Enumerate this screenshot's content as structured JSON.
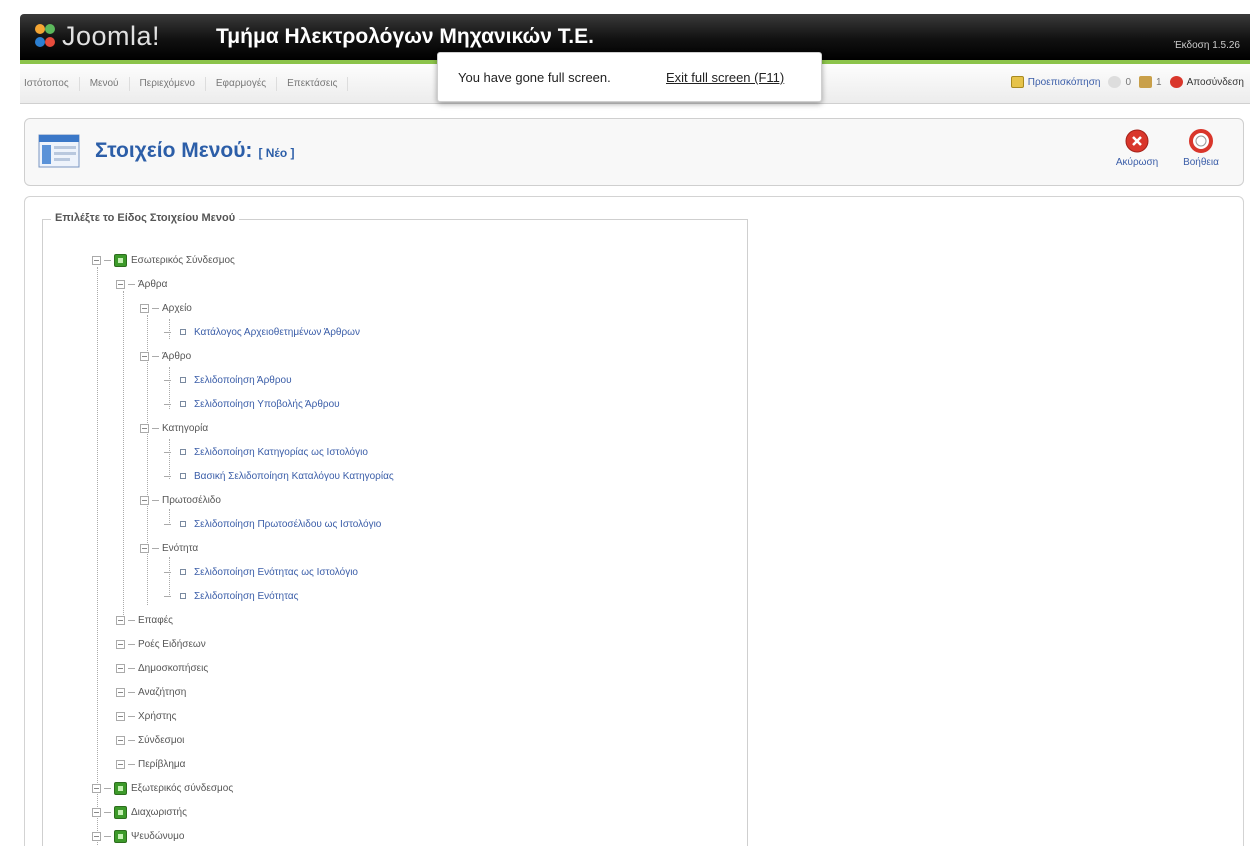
{
  "header": {
    "brand": "Joomla!",
    "site_title": "Τμήμα Ηλεκτρολόγων Μηχανικών Τ.Ε.",
    "version": "Έκδοση 1.5.26"
  },
  "menubar": {
    "items": [
      "Ιστότοπος",
      "Μενού",
      "Περιεχόμενο",
      "Εφαρμογές",
      "Επεκτάσεις"
    ],
    "preview": "Προεπισκόπηση",
    "messages_count": "0",
    "users_count": "1",
    "logout": "Αποσύνδεση"
  },
  "fullscreen_popup": {
    "message": "You have gone full screen.",
    "exit_label": "Exit full screen (F11)"
  },
  "toolbar": {
    "title": "Στοιχείο Μενού:",
    "subtitle": "[ Νέο ]",
    "cancel_label": "Ακύρωση",
    "help_label": "Βοήθεια"
  },
  "content": {
    "legend": "Επιλέξτε το Είδος Στοιχείου Μενού",
    "tree": {
      "internal": "Εσωτερικός Σύνδεσμος",
      "articles": "Άρθρα",
      "archive": "Αρχείο",
      "archive_list": "Κατάλογος Αρχειοθετημένων Άρθρων",
      "article": "Άρθρο",
      "article_layout": "Σελιδοποίηση Άρθρου",
      "article_submit": "Σελιδοποίηση Υποβολής Άρθρου",
      "category": "Κατηγορία",
      "category_blog": "Σελιδοποίηση Κατηγορίας ως Ιστολόγιο",
      "category_list": "Βασική Σελιδοποίηση Καταλόγου Κατηγορίας",
      "frontpage": "Πρωτοσέλιδο",
      "frontpage_blog": "Σελιδοποίηση Πρωτοσέλιδου ως Ιστολόγιο",
      "section": "Ενότητα",
      "section_blog": "Σελιδοποίηση Ενότητας ως Ιστολόγιο",
      "section_layout": "Σελιδοποίηση Ενότητας",
      "contacts": "Επαφές",
      "newsfeeds": "Ροές Ειδήσεων",
      "polls": "Δημοσκοπήσεις",
      "search": "Αναζήτηση",
      "user": "Χρήστης",
      "weblinks": "Σύνδεσμοι",
      "wrapper": "Περίβλημα",
      "external": "Εξωτερικός σύνδεσμος",
      "separator": "Διαχωριστής",
      "alias": "Ψευδώνυμο"
    }
  },
  "colors": {
    "accent_green": "#8bc34a",
    "title_blue": "#2c5ea8",
    "link_blue": "#3a5da8",
    "cancel_red": "#d9362b",
    "help_red": "#d9362b"
  }
}
